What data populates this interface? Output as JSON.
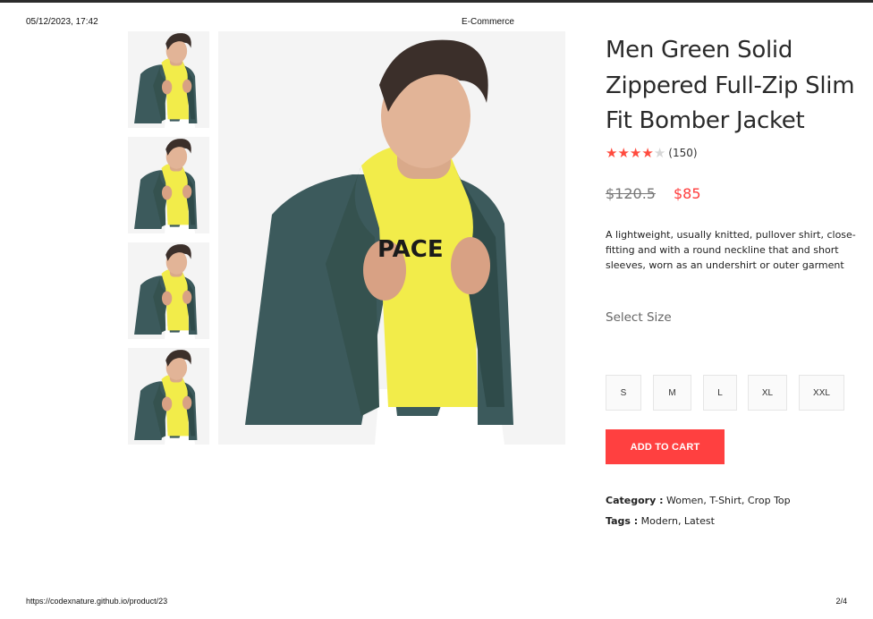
{
  "print_header": {
    "datetime": "05/12/2023, 17:42",
    "site_title": "E-Commerce"
  },
  "print_footer": {
    "url": "https://codexnature.github.io/product/23",
    "page": "2/4"
  },
  "gallery": {
    "thumbnails": [
      {
        "alt": "product-photo"
      },
      {
        "alt": "product-photo"
      },
      {
        "alt": "product-photo"
      },
      {
        "alt": "product-photo"
      }
    ],
    "shirt_text": "PACE"
  },
  "product": {
    "title": "Men Green Solid Zippered Full-Zip Slim Fit Bomber Jacket",
    "rating": {
      "stars": 4,
      "max": 5,
      "count": "(150)"
    },
    "old_price": "$120.5",
    "new_price": "$85",
    "description": "A lightweight, usually knitted, pullover shirt, close-fitting and with a round neckline that and short sleeves, worn as an undershirt or outer garment",
    "size_heading": "Select Size",
    "sizes": [
      "S",
      "M",
      "L",
      "XL",
      "XXL"
    ],
    "add_to_cart": "ADD TO CART",
    "category_label": "Category :",
    "category_value": " Women, T-Shirt, Crop Top",
    "tags_label": "Tags :",
    "tags_value": " Modern, Latest"
  },
  "colors": {
    "accent": "#ff4040",
    "jacket": "#3c5a5c",
    "hoodie": "#f2ec4a"
  }
}
